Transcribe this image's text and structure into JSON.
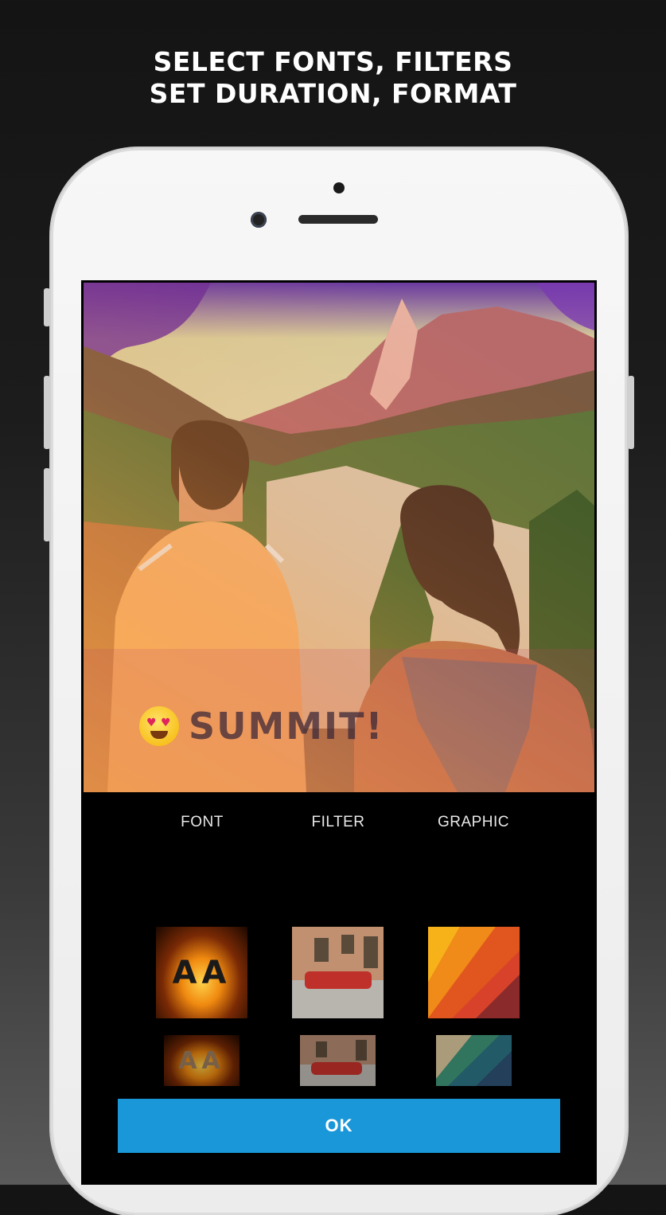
{
  "headline": {
    "line1": "SELECT FONTS, FILTERS",
    "line2": "SET DURATION, FORMAT"
  },
  "preview": {
    "caption_text": "SUMMIT!",
    "caption_emoji": "heart-eyes-emoji"
  },
  "tabs": [
    {
      "label": "FONT"
    },
    {
      "label": "FILTER"
    },
    {
      "label": "GRAPHIC"
    }
  ],
  "options": {
    "font_sample": "AA",
    "font_sample_small": "AA"
  },
  "ok_button": {
    "label": "OK"
  },
  "colors": {
    "accent": "#1a97d8",
    "screen_bg": "#000000"
  }
}
